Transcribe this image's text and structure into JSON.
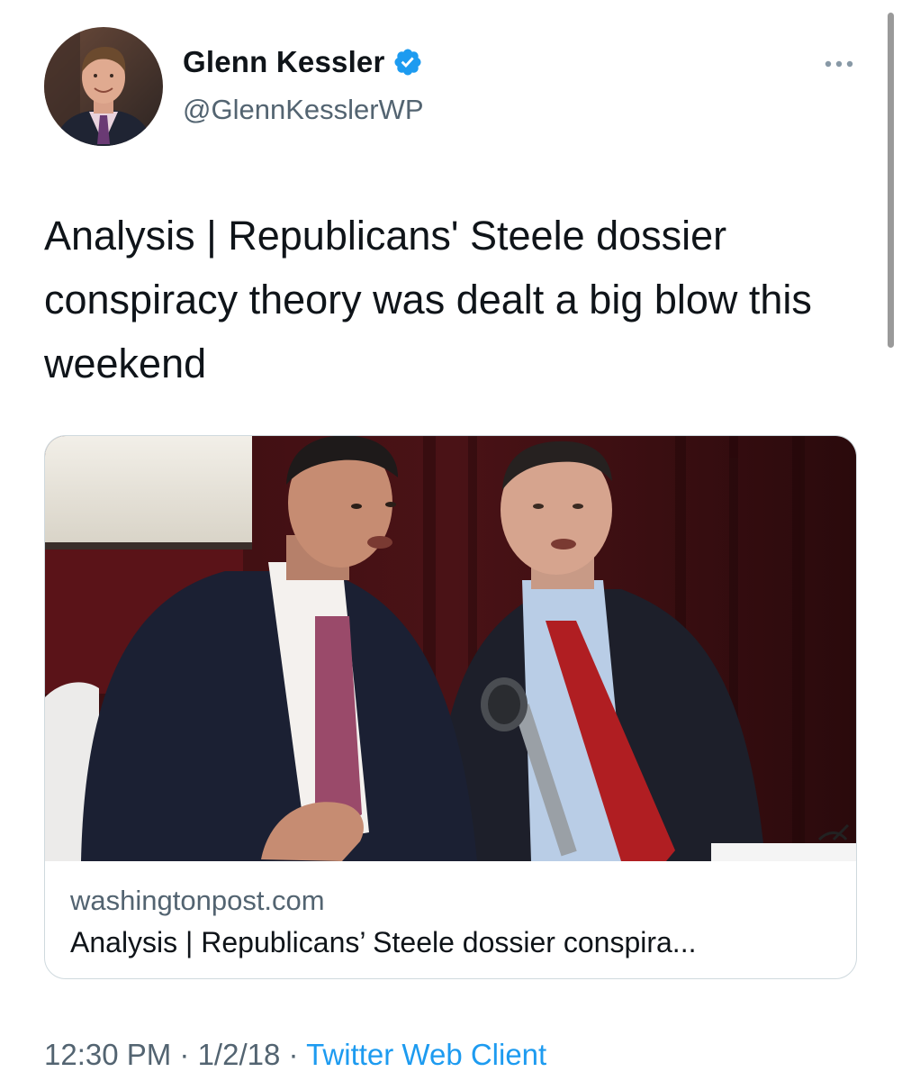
{
  "author": {
    "name": "Glenn Kessler",
    "handle": "@GlennKesslerWP",
    "verified": true
  },
  "tweet": {
    "text": "Analysis | Republicans' Steele dossier conspiracy theory was dealt a big blow this weekend"
  },
  "card": {
    "domain": "washingtonpost.com",
    "title": "Analysis | Republicans’ Steele dossier conspira..."
  },
  "meta": {
    "time": "12:30 PM",
    "separator1": " · ",
    "date": "1/2/18",
    "separator2": " · ",
    "source": "Twitter Web Client"
  },
  "icons": {
    "verified": "verified-badge-icon",
    "more": "more-options-icon"
  },
  "colors": {
    "accent": "#1d9bf0",
    "text": "#0f1419",
    "muted": "#536471",
    "border": "#cfd9de"
  }
}
